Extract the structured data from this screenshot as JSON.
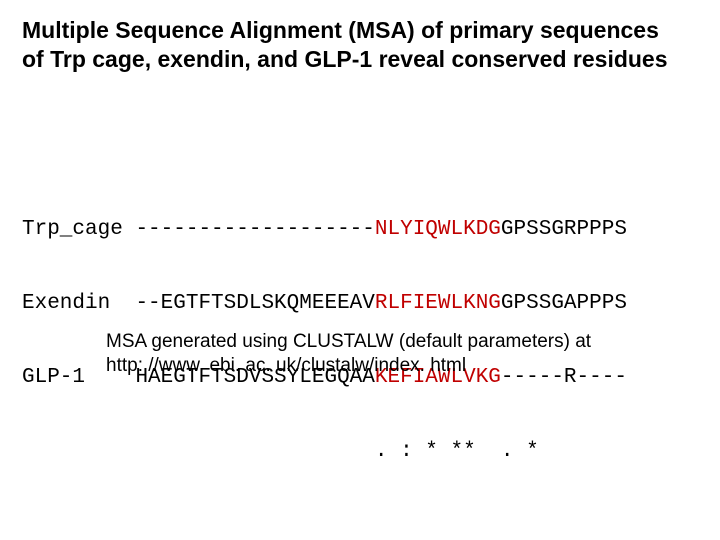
{
  "title_line1": "Multiple Sequence Alignment (MSA) of primary sequences",
  "title_line2": "of Trp cage, exendin, and GLP-1 reveal conserved residues",
  "align": {
    "rows": [
      {
        "label": "Trp_cage",
        "pre": "-------------------",
        "hl": "NLYIQWLKDG",
        "post": "GPSSGRPPPS"
      },
      {
        "label": "Exendin ",
        "pre": "--EGTFTSDLSKQMEEEAV",
        "hl": "RLFIEWLKNG",
        "post": "GPSSGAPPPS"
      },
      {
        "label": "GLP-1   ",
        "pre": "HAEGTFTSDVSSYLEGQAA",
        "hl": "KEFIAWLVKG",
        "post": "-----R----"
      }
    ],
    "consensus_pad": "                            ",
    "consensus": ". : * **  . *"
  },
  "caption_line1": "MSA generated using CLUSTALW (default parameters) at",
  "caption_line2": "http: //www. ebi. ac. uk/clustalw/index. html"
}
